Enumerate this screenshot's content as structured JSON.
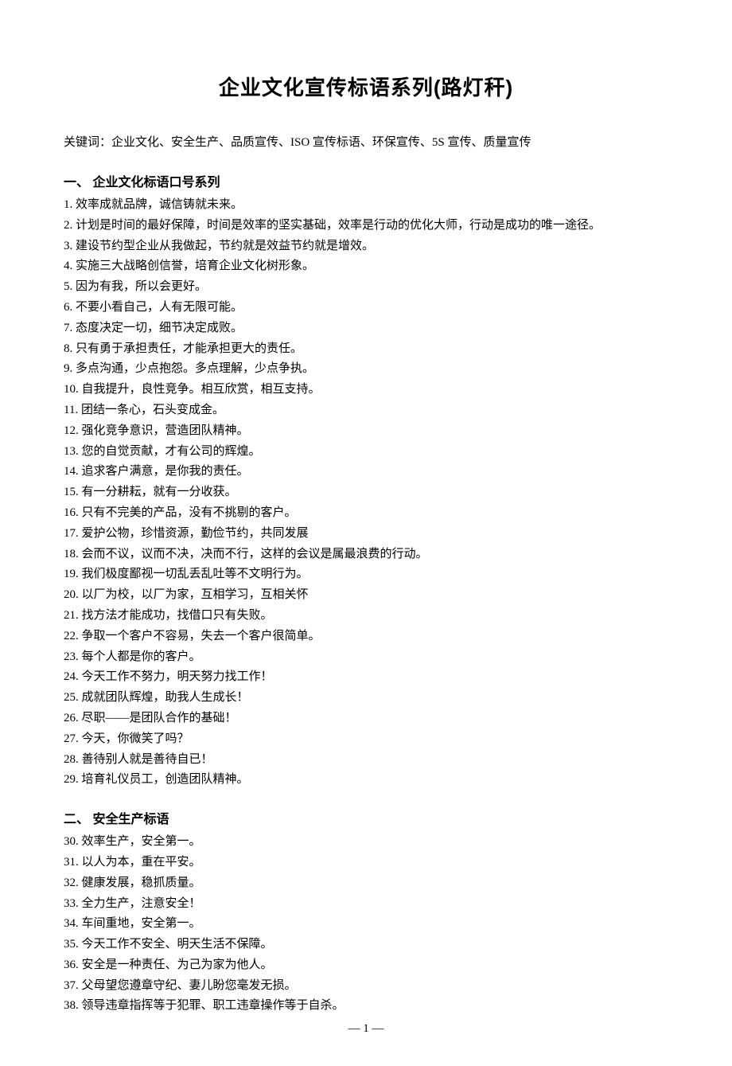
{
  "title": "企业文化宣传标语系列(路灯秆)",
  "keywords": "关键词：企业文化、安全生产、品质宣传、ISO 宣传标语、环保宣传、5S 宣传、质量宣传",
  "section1": {
    "header": "一、 企业文化标语口号系列",
    "i1": "1. 效率成就品牌，诚信铸就未来。",
    "i2": "2. 计划是时间的最好保障，时间是效率的坚实基础，效率是行动的优化大师，行动是成功的唯一途径。",
    "i3": "3. 建设节约型企业从我做起，节约就是效益节约就是增效。",
    "i4": "4. 实施三大战略创信誉，培育企业文化树形象。",
    "i5": "5. 因为有我，所以会更好。",
    "i6": "6. 不要小看自己，人有无限可能。",
    "i7": "7. 态度决定一切，细节决定成败。",
    "i8": "8. 只有勇于承担责任，才能承担更大的责任。",
    "i9": "9. 多点沟通，少点抱怨。多点理解，少点争执。",
    "i10": "10. 自我提升，良性竞争。相互欣赏，相互支持。",
    "i11": "11. 团结一条心，石头变成金。",
    "i12": "12. 强化竞争意识，营造团队精神。",
    "i13": "13. 您的自觉贡献，才有公司的辉煌。",
    "i14": "14. 追求客户满意，是你我的责任。",
    "i15": "15. 有一分耕耘，就有一分收获。",
    "i16": "16. 只有不完美的产品，没有不挑剔的客户。",
    "i17": "17.  爱护公物，珍惜资源，勤俭节约，共同发展",
    "i18": "18.  会而不议，议而不决，决而不行，这样的会议是属最浪费的行动。",
    "i19": "19.  我们极度鄙视一切乱丢乱吐等不文明行为。",
    "i20": "20.  以厂为校，以厂为家，互相学习，互相关怀",
    "i21": "21. 找方法才能成功，找借口只有失败。",
    "i22": "22. 争取一个客户不容易，失去一个客户很简单。",
    "i23": "23. 每个人都是你的客户。",
    "i24": "24. 今天工作不努力，明天努力找工作！",
    "i25": "25. 成就团队辉煌，助我人生成长！",
    "i26": "26. 尽职——是团队合作的基础！",
    "i27": "27. 今天，你微笑了吗？",
    "i28": "28. 善待别人就是善待自已！",
    "i29": "29. 培育礼仪员工，创造团队精神。"
  },
  "section2": {
    "header": "二、 安全生产标语",
    "i30": "30. 效率生产，安全第一。",
    "i31": "31. 以人为本，重在平安。",
    "i32": "32. 健康发展，稳抓质量。",
    "i33": "33. 全力生产，注意安全！",
    "i34": "34. 车间重地，安全第一。",
    "i35": "35. 今天工作不安全、明天生活不保障。",
    "i36": "36. 安全是一种责任、为己为家为他人。",
    "i37": "37. 父母望您遵章守纪、妻儿盼您毫发无损。",
    "i38": "38. 领导违章指挥等于犯罪、职工违章操作等于自杀。"
  },
  "footer": "— 1 —"
}
